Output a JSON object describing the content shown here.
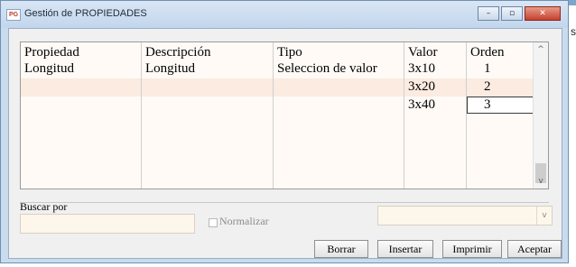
{
  "window": {
    "title": "Gestión de PROPIEDADES",
    "icon_text": "PG",
    "controls": {
      "minimize": "–",
      "maximize": "▫",
      "close": "✕"
    }
  },
  "grid": {
    "columns": [
      "Propiedad",
      "Descripción",
      "Tipo",
      "Valor",
      "Orden"
    ],
    "rows": [
      {
        "propiedad": "Longitud",
        "descripcion": "Longitud",
        "tipo": "Seleccion de valor",
        "valor": "3x10",
        "orden": "1"
      },
      {
        "propiedad": "",
        "descripcion": "",
        "tipo": "",
        "valor": "3x20",
        "orden": "2"
      },
      {
        "propiedad": "",
        "descripcion": "",
        "tipo": "",
        "valor": "3x40",
        "orden": "3"
      }
    ],
    "scroll_up": "^",
    "scroll_down": "v"
  },
  "search": {
    "label": "Buscar por",
    "value": "",
    "normalize_label": "Normalizar",
    "normalize_checked": false,
    "combo_value": "",
    "combo_arrow": "v"
  },
  "buttons": {
    "borrar": "Borrar",
    "insertar": "Insertar",
    "imprimir": "Imprimir",
    "aceptar": "Aceptar"
  },
  "background_glyph": "s",
  "colors": {
    "title_bar": "#c2d6ec",
    "grid_background": "#fffaf6",
    "row_band": "#fbebe0",
    "input_background": "#fdf6ea",
    "close_button": "#c5412e"
  }
}
